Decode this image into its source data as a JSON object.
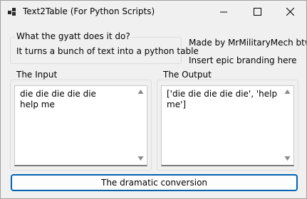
{
  "window": {
    "title": "Text2Table (For Python Scripts)"
  },
  "info_group": {
    "legend": "What the gyatt does it do?",
    "description": "It turns a bunch of text into a python table"
  },
  "branding": {
    "credit": "Made by MrMilitaryMech btw",
    "tagline": "Insert epic branding here"
  },
  "input_group": {
    "legend": "The Input",
    "text": "die die die die die\nhelp me"
  },
  "output_group": {
    "legend": "The Output",
    "text": "['die die die die die', 'help\nme']"
  },
  "convert_button": {
    "label": "The dramatic conversion"
  },
  "colors": {
    "window_bg": "#f0f0f0",
    "button_accent": "#0063b1",
    "textarea_bg": "#ffffff"
  }
}
